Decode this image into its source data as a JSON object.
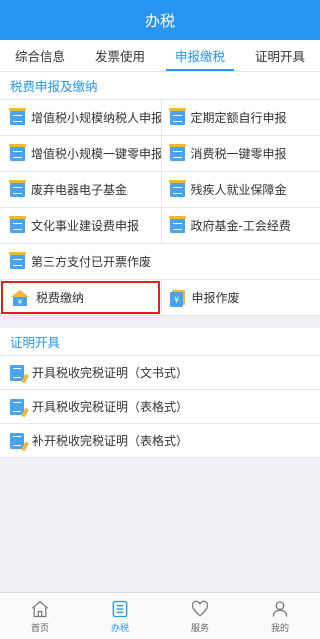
{
  "header": {
    "title": "办税"
  },
  "tabs": [
    {
      "label": "综合信息"
    },
    {
      "label": "发票使用"
    },
    {
      "label": "申报缴税"
    },
    {
      "label": "证明开具"
    }
  ],
  "active_tab": "申报缴税",
  "declare_section": {
    "title": "税费申报及缴纳",
    "items": [
      {
        "label": "增值税小规模纳税人申报"
      },
      {
        "label": "定期定额自行申报"
      },
      {
        "label": "增值税小规模一键零申报"
      },
      {
        "label": "消费税一键零申报"
      },
      {
        "label": "废弃电器电子基金"
      },
      {
        "label": "残疾人就业保障金"
      },
      {
        "label": "文化事业建设费申报"
      },
      {
        "label": "政府基金-工会经费"
      },
      {
        "label": "第三方支付已开票作废"
      },
      {
        "label": "税费缴纳"
      },
      {
        "label": "申报作废"
      }
    ]
  },
  "cert_section": {
    "title": "证明开具",
    "items": [
      {
        "label": "开具税收完税证明（文书式）"
      },
      {
        "label": "开具税收完税证明（表格式）"
      },
      {
        "label": "补开税收完税证明（表格式）"
      }
    ]
  },
  "bottom_nav": [
    {
      "label": "首页",
      "icon": "home-icon"
    },
    {
      "label": "办税",
      "icon": "list-icon"
    },
    {
      "label": "服务",
      "icon": "heart-icon"
    },
    {
      "label": "我的",
      "icon": "user-icon"
    }
  ],
  "colors": {
    "accent": "#2896f0",
    "highlight": "#e02020"
  }
}
